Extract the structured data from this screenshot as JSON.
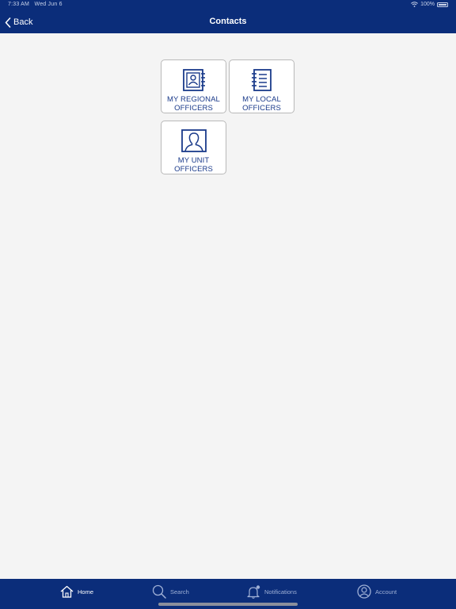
{
  "status_bar": {
    "time": "7:33 AM",
    "date": "Wed Jun 6",
    "battery": "100%"
  },
  "nav": {
    "back_label": "Back",
    "title": "Contacts"
  },
  "tiles": [
    {
      "line1": "MY REGIONAL",
      "line2": "OFFICERS",
      "icon": "contact-card-icon"
    },
    {
      "line1": "MY LOCAL",
      "line2": "OFFICERS",
      "icon": "notebook-list-icon"
    },
    {
      "line1": "MY UNIT",
      "line2": "OFFICERS",
      "icon": "person-frame-icon"
    }
  ],
  "tab_bar": {
    "items": [
      {
        "label": "Home",
        "icon": "home-icon",
        "active": true
      },
      {
        "label": "Search",
        "icon": "search-icon",
        "active": false
      },
      {
        "label": "Notifications",
        "icon": "bell-icon",
        "active": false
      },
      {
        "label": "Account",
        "icon": "account-icon",
        "active": false
      }
    ]
  },
  "colors": {
    "brand": "#0b2d7a",
    "tile_text": "#1a3a8a",
    "background": "#f4f4f4"
  }
}
